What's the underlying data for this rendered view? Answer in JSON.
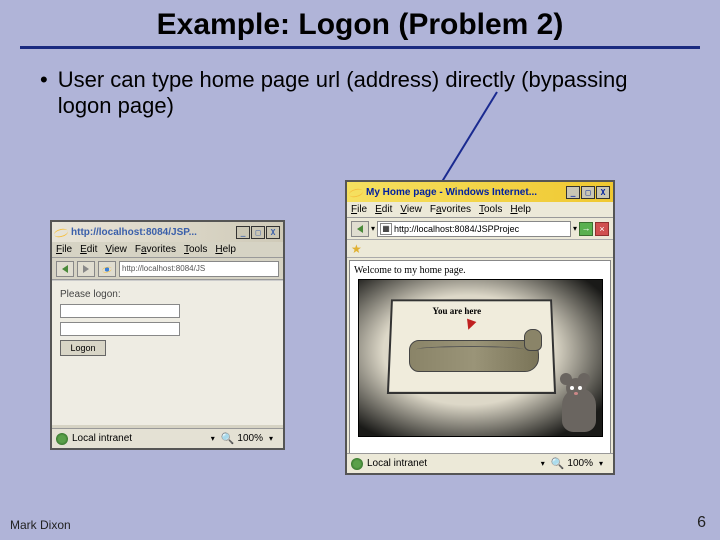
{
  "title": "Example: Logon (Problem 2)",
  "bullet_text": "User can type home page url (address) directly (bypassing logon page)",
  "footer": {
    "author": "Mark Dixon",
    "page_number": "6"
  },
  "left_browser": {
    "title": "http://localhost:8084/JSP...",
    "window_buttons": {
      "min": "_",
      "max": "□",
      "close": "X"
    },
    "menu": {
      "file": "File",
      "edit": "Edit",
      "view": "View",
      "favorites": "Favorites",
      "tools": "Tools",
      "help": "Help"
    },
    "url": "http://localhost:8084/JS",
    "content": {
      "label": "Please logon:",
      "button": "Logon"
    },
    "status": {
      "zone_text": "Local intranet",
      "zoom": "100%"
    }
  },
  "right_browser": {
    "title": "My Home page - Windows Internet...",
    "window_buttons": {
      "min": "_",
      "max": "□",
      "close": "X"
    },
    "menu": {
      "file": "File",
      "edit": "Edit",
      "view": "View",
      "favorites": "Favorites",
      "tools": "Tools",
      "help": "Help"
    },
    "url": "http://localhost:8084/JSPProjec",
    "welcome": "Welcome to my home page.",
    "cartoon_caption": "You are here",
    "status": {
      "zone_text": "Local intranet",
      "zoom": "100%"
    },
    "go_btn": "→",
    "stop_btn": "×"
  }
}
